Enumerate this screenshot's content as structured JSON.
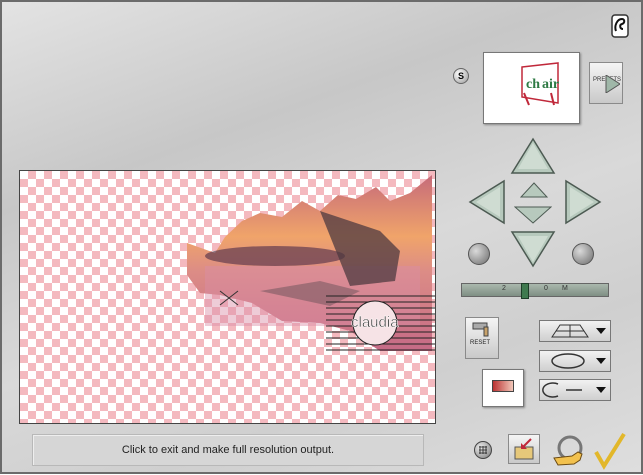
{
  "status": {
    "message": "Click to exit and make full resolution output."
  },
  "thumbnail": {
    "text": "chair"
  },
  "presets": {
    "label": "PRESETS"
  },
  "s_button": {
    "label": "S"
  },
  "reset": {
    "label": "RESET"
  },
  "slider": {
    "left_label": "2",
    "mid_label": "0",
    "right_label": "M"
  },
  "watermark": {
    "text": "claudia"
  },
  "colors": {
    "checker": "#f4b9bf",
    "panel": "#d9d9d9",
    "arrow": "#b7c9bd"
  }
}
